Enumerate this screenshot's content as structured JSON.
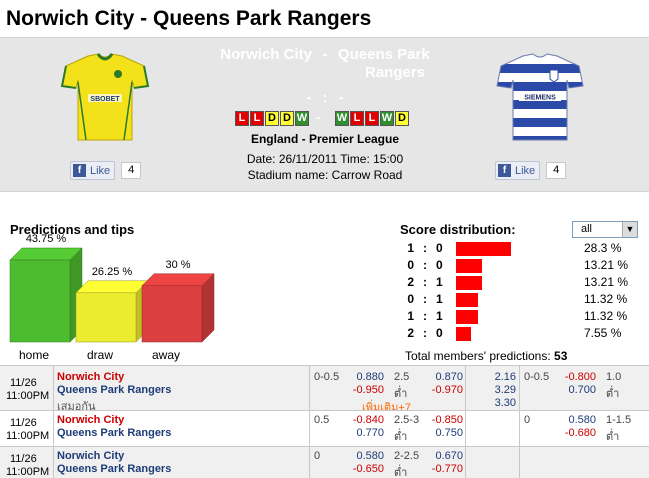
{
  "title": "Norwich City - Queens Park Rangers",
  "header": {
    "home_team": "Norwich City",
    "away_team": "Queens Park",
    "away_team_line2": "Rangers",
    "separator": "-",
    "score_home": "-",
    "score_sep": ":",
    "score_away": "-",
    "form_sep": "-",
    "home_form": [
      "L",
      "L",
      "D",
      "D",
      "W"
    ],
    "away_form": [
      "W",
      "L",
      "L",
      "W",
      "D"
    ],
    "league": "England - Premier League",
    "date_line": "Date: 26/11/2011 Time: 15:00",
    "stadium_line": "Stadium name: Carrow Road",
    "home_shirt_text": "SBOBET",
    "away_shirt_text": "SIEMENS",
    "home_like_label": "Like",
    "home_like_count": "4",
    "away_like_label": "Like",
    "away_like_count": "4",
    "fb_letter": "f"
  },
  "predictions": {
    "title": "Predictions and tips",
    "bars": [
      {
        "label": "home",
        "pct": "43.75 %",
        "value": 43.75,
        "color": "#55cc33"
      },
      {
        "label": "draw",
        "pct": "26.25 %",
        "value": 26.25,
        "color": "#ffff33"
      },
      {
        "label": "away",
        "pct": "30 %",
        "value": 30,
        "color": "#ee4444"
      }
    ]
  },
  "distribution": {
    "title": "Score distribution:",
    "filter_value": "all",
    "rows": [
      {
        "a": "1",
        "b": "0",
        "pct": "28.3 %",
        "value": 28.3
      },
      {
        "a": "0",
        "b": "0",
        "pct": "13.21 %",
        "value": 13.21
      },
      {
        "a": "2",
        "b": "1",
        "pct": "13.21 %",
        "value": 13.21
      },
      {
        "a": "0",
        "b": "1",
        "pct": "11.32 %",
        "value": 11.32
      },
      {
        "a": "1",
        "b": "1",
        "pct": "11.32 %",
        "value": 11.32
      },
      {
        "a": "2",
        "b": "0",
        "pct": "7.55 %",
        "value": 7.55
      }
    ],
    "total_label": "Total members' predictions:",
    "total_value": "53"
  },
  "odds": [
    {
      "date": "11/26",
      "time": "11:00PM",
      "home": "Norwich City",
      "away": "Queens Park Rangers",
      "draw_label": "เสมอกัน",
      "hdp": "0-0.5",
      "hdp_home": "0.880",
      "hdp_away": "-0.950",
      "ou": "2.5",
      "ou_under": "ต่ำ",
      "ou_over": "0.870",
      "ou_under_val": "-0.970",
      "x12_home": "2.16",
      "x12_away": "3.29",
      "x12_draw": "3.30",
      "more": "เพิ่มเติม+7",
      "h1_hdp": "0-0.5",
      "h1_home": "-0.800",
      "h1_away": "0.700",
      "h1_ou": "1.0",
      "h1_under": "ต่ำ"
    },
    {
      "date": "11/26",
      "time": "11:00PM",
      "home": "Norwich City",
      "away": "Queens Park Rangers",
      "hdp": "0.5",
      "hdp_home": "-0.840",
      "hdp_away": "0.770",
      "ou": "2.5-3",
      "ou_under": "ต่ำ",
      "ou_over": "-0.850",
      "ou_under_val": "0.750",
      "h1_hdp": "0",
      "h1_home": "0.580",
      "h1_away": "-0.680",
      "h1_ou": "1-1.5",
      "h1_under": "ต่ำ"
    },
    {
      "date": "11/26",
      "time": "11:00PM",
      "home": "Norwich City",
      "away": "Queens Park Rangers",
      "hdp": "0",
      "hdp_home": "0.580",
      "hdp_away": "-0.650",
      "ou": "2-2.5",
      "ou_under": "ต่ำ",
      "ou_over": "0.670",
      "ou_under_val": "-0.770"
    }
  ]
}
